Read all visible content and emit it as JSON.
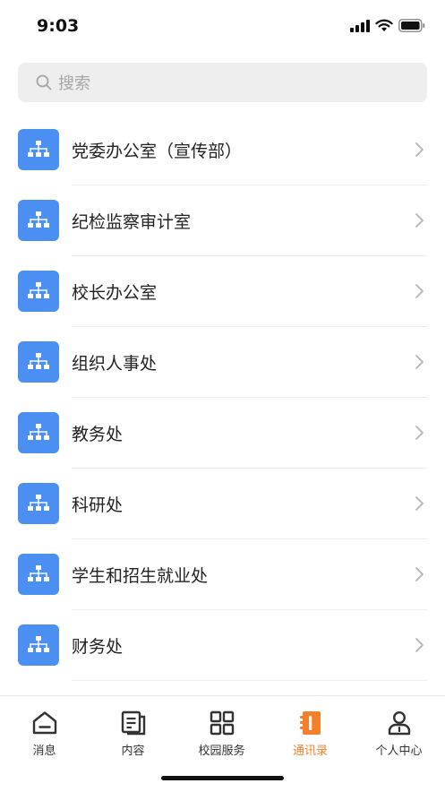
{
  "status_bar": {
    "time": "9:03",
    "icons": [
      "signal-icon",
      "wifi-icon",
      "battery-icon"
    ]
  },
  "search": {
    "placeholder": "搜索",
    "icon": "search-icon"
  },
  "departments": [
    {
      "label": "党委办公室（宣传部）",
      "icon": "org-chart-icon"
    },
    {
      "label": "纪检监察审计室",
      "icon": "org-chart-icon"
    },
    {
      "label": "校长办公室",
      "icon": "org-chart-icon"
    },
    {
      "label": "组织人事处",
      "icon": "org-chart-icon"
    },
    {
      "label": "教务处",
      "icon": "org-chart-icon"
    },
    {
      "label": "科研处",
      "icon": "org-chart-icon"
    },
    {
      "label": "学生和招生就业处",
      "icon": "org-chart-icon"
    },
    {
      "label": "财务处",
      "icon": "org-chart-icon"
    }
  ],
  "tab_bar": {
    "tabs": [
      {
        "label": "消息",
        "icon": "inbox-icon",
        "active": false
      },
      {
        "label": "内容",
        "icon": "document-icon",
        "active": false
      },
      {
        "label": "校园服务",
        "icon": "grid-icon",
        "active": false
      },
      {
        "label": "通讯录",
        "icon": "contacts-book-icon",
        "active": true
      },
      {
        "label": "个人中心",
        "icon": "person-icon",
        "active": false
      }
    ]
  },
  "colors": {
    "accent": "#f4802b",
    "icon_blue": "#4a8ff1",
    "search_bg": "#eeeeee"
  }
}
